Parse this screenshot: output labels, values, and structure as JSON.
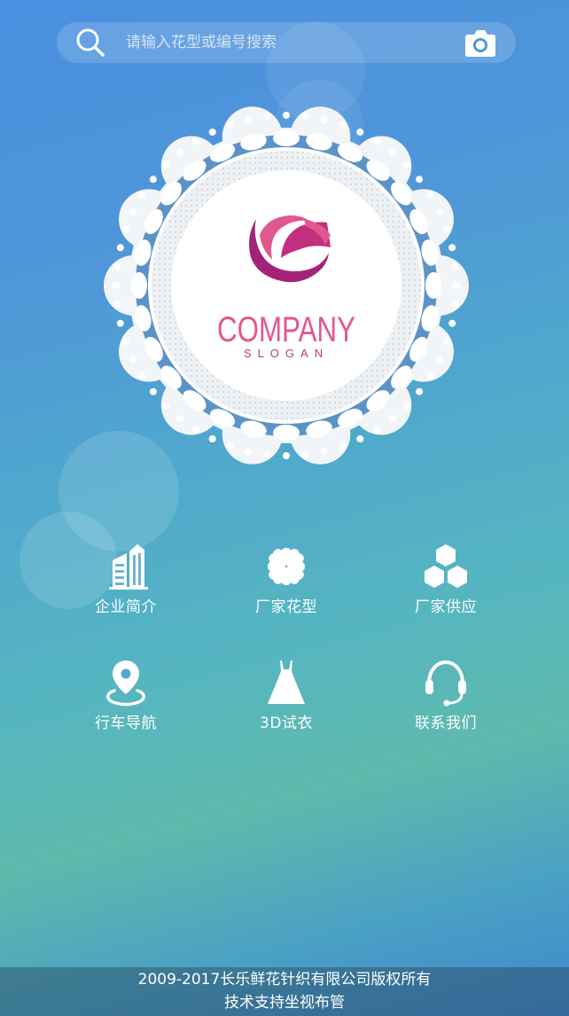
{
  "search": {
    "placeholder": "请输入花型或编号搜索"
  },
  "logo": {
    "brand": "COMPANY",
    "slogan": "SLOGAN"
  },
  "menu": {
    "items": [
      {
        "label": "企业简介",
        "icon": "building-icon"
      },
      {
        "label": "厂家花型",
        "icon": "clover-icon"
      },
      {
        "label": "厂家供应",
        "icon": "hexagon-cluster-icon"
      },
      {
        "label": "行车导航",
        "icon": "location-pin-icon"
      },
      {
        "label": "3D试衣",
        "icon": "dress-icon"
      },
      {
        "label": "联系我们",
        "icon": "headset-icon"
      }
    ]
  },
  "footer": {
    "copyright": "2009-2017长乐鲜花针织有限公司版权所有",
    "support": "技术支持坐视布管"
  },
  "colors": {
    "accent_pink": "#e0588f",
    "accent_magenta": "#a4237a",
    "lace_blue": "#5a93c8"
  }
}
